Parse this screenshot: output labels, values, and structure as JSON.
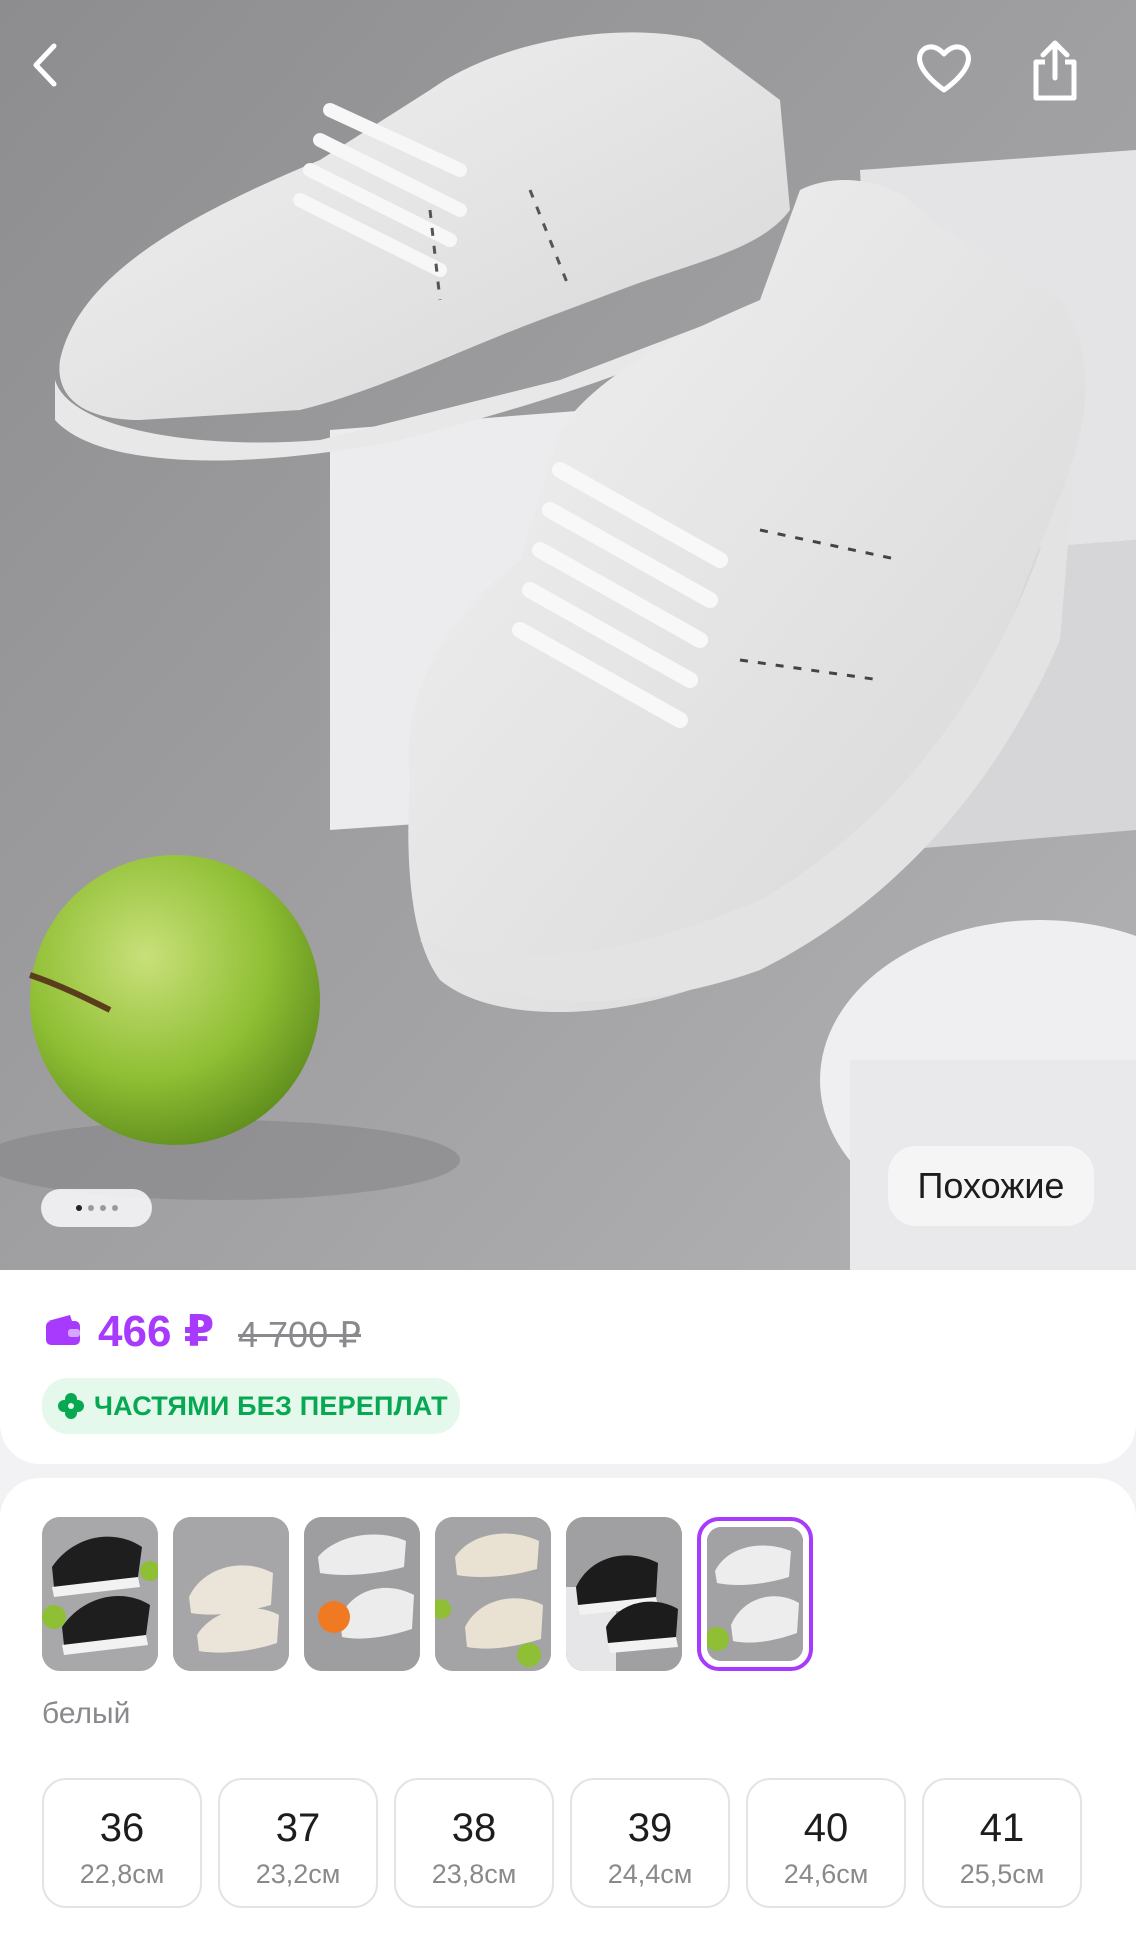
{
  "hero": {
    "image_alt": "white platform sneakers with green apple",
    "similar_label": "Похожие",
    "dots_count": 4,
    "active_dot": 0
  },
  "icons": {
    "back": "chevron-left-icon",
    "favorite": "heart-icon",
    "share": "share-icon",
    "wallet": "wallet-icon",
    "clover": "clover-icon"
  },
  "pricing": {
    "price": "466 ₽",
    "old_price": "4 700 ₽",
    "installment_label": "ЧАСТЯМИ БЕЗ ПЕРЕПЛАТ",
    "price_color": "#a73afd",
    "installment_color": "#06a852"
  },
  "variants": {
    "selected_index": 5,
    "selected_color": "белый",
    "thumbnails": [
      "black",
      "beige",
      "white-orange",
      "beige-apple",
      "black-2",
      "white"
    ]
  },
  "sizes": [
    {
      "size": "36",
      "length": "22,8см"
    },
    {
      "size": "37",
      "length": "23,2см"
    },
    {
      "size": "38",
      "length": "23,8см"
    },
    {
      "size": "39",
      "length": "24,4см"
    },
    {
      "size": "40",
      "length": "24,6см"
    },
    {
      "size": "41",
      "length": "25,5см"
    }
  ]
}
